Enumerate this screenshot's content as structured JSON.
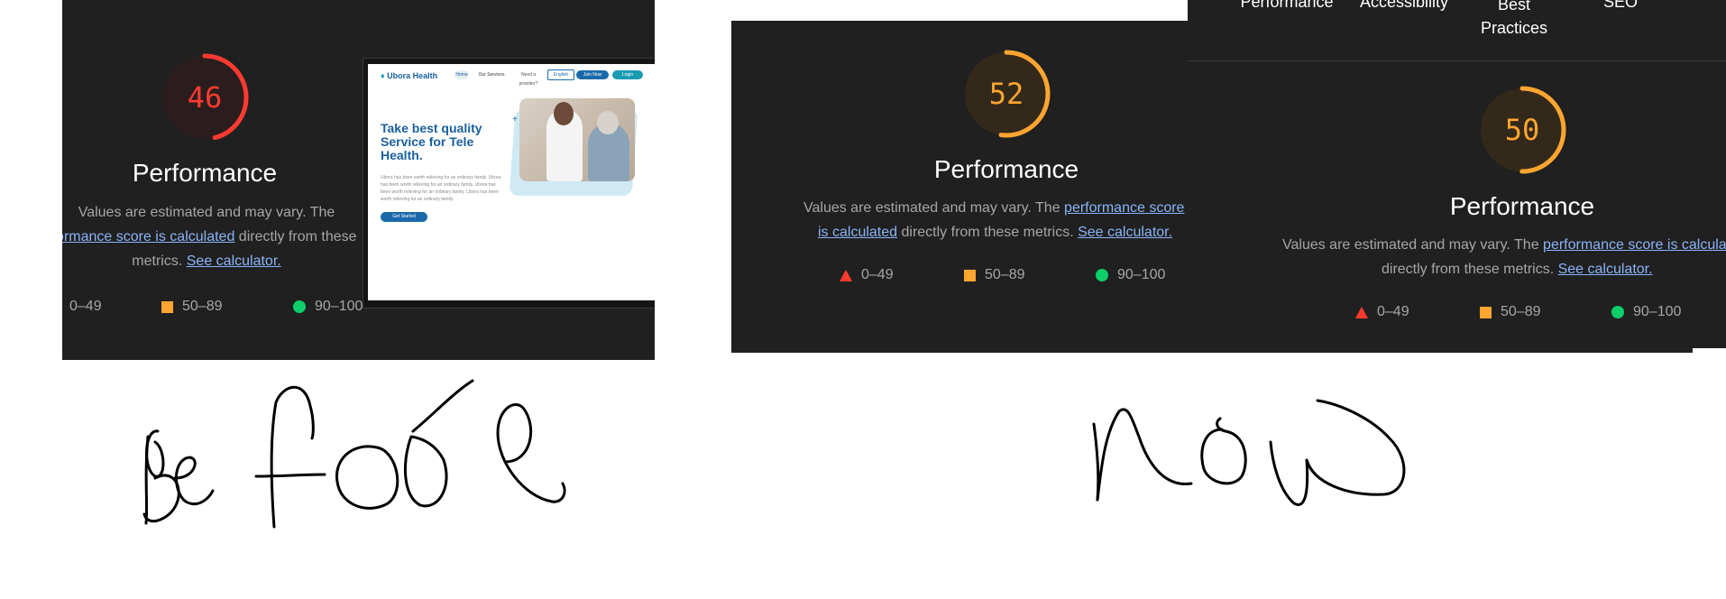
{
  "before_panel": {
    "score": "46",
    "score_fraction": 0.46,
    "score_color": "#ff3b30",
    "title": "Performance",
    "desc_line1": "Values are estimated and may vary. The",
    "desc_link1": "performance score is calculated",
    "desc_mid": " directly from these",
    "desc_line3_pre": "metrics.",
    "desc_link2": "See calculator.",
    "legend": {
      "fail": "0–49",
      "average": "50–89",
      "pass": "90–100"
    }
  },
  "website_preview": {
    "logo_text": "Ubora Health",
    "nav_home": "Home",
    "nav_services": "Our Services",
    "nav_provider": "Need a provider?",
    "nav_language": "English",
    "nav_join": "Join Now",
    "nav_login": "Login",
    "hero_title": "Take best quality Service for Tele Health.",
    "hero_text": "Ubora has been worth relieving for an ordinary family. Ubora has been worth relieving for an ordinary family. Ubora has been worth relieving for an ordinary family. Ubora has been worth relieving for an ordinary family.",
    "cta_label": "Get Started"
  },
  "now_panel_1": {
    "score": "52",
    "score_fraction": 0.52,
    "score_color": "#ffa530",
    "title": "Performance",
    "desc_line1": "Values are estimated and may vary. The",
    "desc_link1": "performance score",
    "desc_link1b": "is calculated",
    "desc_mid": " directly from these metrics.",
    "desc_link2": "See calculator.",
    "legend": {
      "fail": "0–49",
      "average": "50–89",
      "pass": "90–100"
    }
  },
  "now_panel_2": {
    "tabs": [
      "Performance",
      "Accessibility",
      "Best Practices",
      "SEO"
    ],
    "score": "50",
    "score_fraction": 0.5,
    "score_color": "#ffa530",
    "title": "Performance",
    "desc_line1": "Values are estimated and may vary. The",
    "desc_link1": "performance score is calculated",
    "desc_mid": "directly from these metrics.",
    "desc_link2": "See calculator.",
    "legend": {
      "fail": "0–49",
      "average": "50–89",
      "pass": "90–100"
    }
  },
  "handwriting": {
    "before_label": "Before",
    "now_label": "now"
  },
  "colors": {
    "panel_bg": "#202020",
    "fail": "#ff3b30",
    "average": "#ffa530",
    "pass": "#0cce6b",
    "link": "#8ab4f8"
  }
}
